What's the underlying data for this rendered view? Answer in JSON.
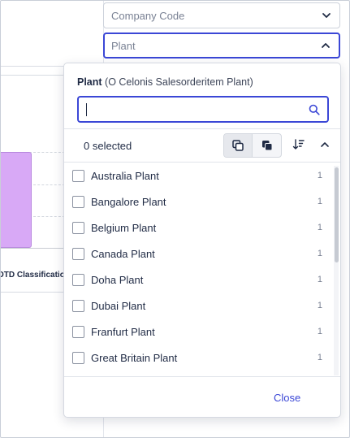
{
  "filters": {
    "company_code": {
      "placeholder": "Company Code"
    },
    "plant": {
      "placeholder": "Plant"
    }
  },
  "chart": {
    "axis_label": "OTD Classificatio"
  },
  "dropdown": {
    "title_bold": "Plant",
    "title_rest": " (O Celonis Salesorderitem Plant)",
    "search_value": "",
    "selected_count_text": "0 selected",
    "items": [
      {
        "label": "Australia Plant",
        "count": "1"
      },
      {
        "label": "Bangalore Plant",
        "count": "1"
      },
      {
        "label": "Belgium Plant",
        "count": "1"
      },
      {
        "label": "Canada Plant",
        "count": "1"
      },
      {
        "label": "Doha Plant",
        "count": "1"
      },
      {
        "label": "Dubai Plant",
        "count": "1"
      },
      {
        "label": "Franfurt Plant",
        "count": "1"
      },
      {
        "label": "Great Britain Plant",
        "count": "1"
      }
    ],
    "close_label": "Close"
  },
  "colors": {
    "accent": "#3b47d6",
    "bar": "#d8a9f6"
  },
  "icons": [
    "chevron-down-icon",
    "chevron-up-icon",
    "search-icon",
    "select-all-icon",
    "deselect-icon",
    "sort-icon",
    "collapse-icon"
  ]
}
